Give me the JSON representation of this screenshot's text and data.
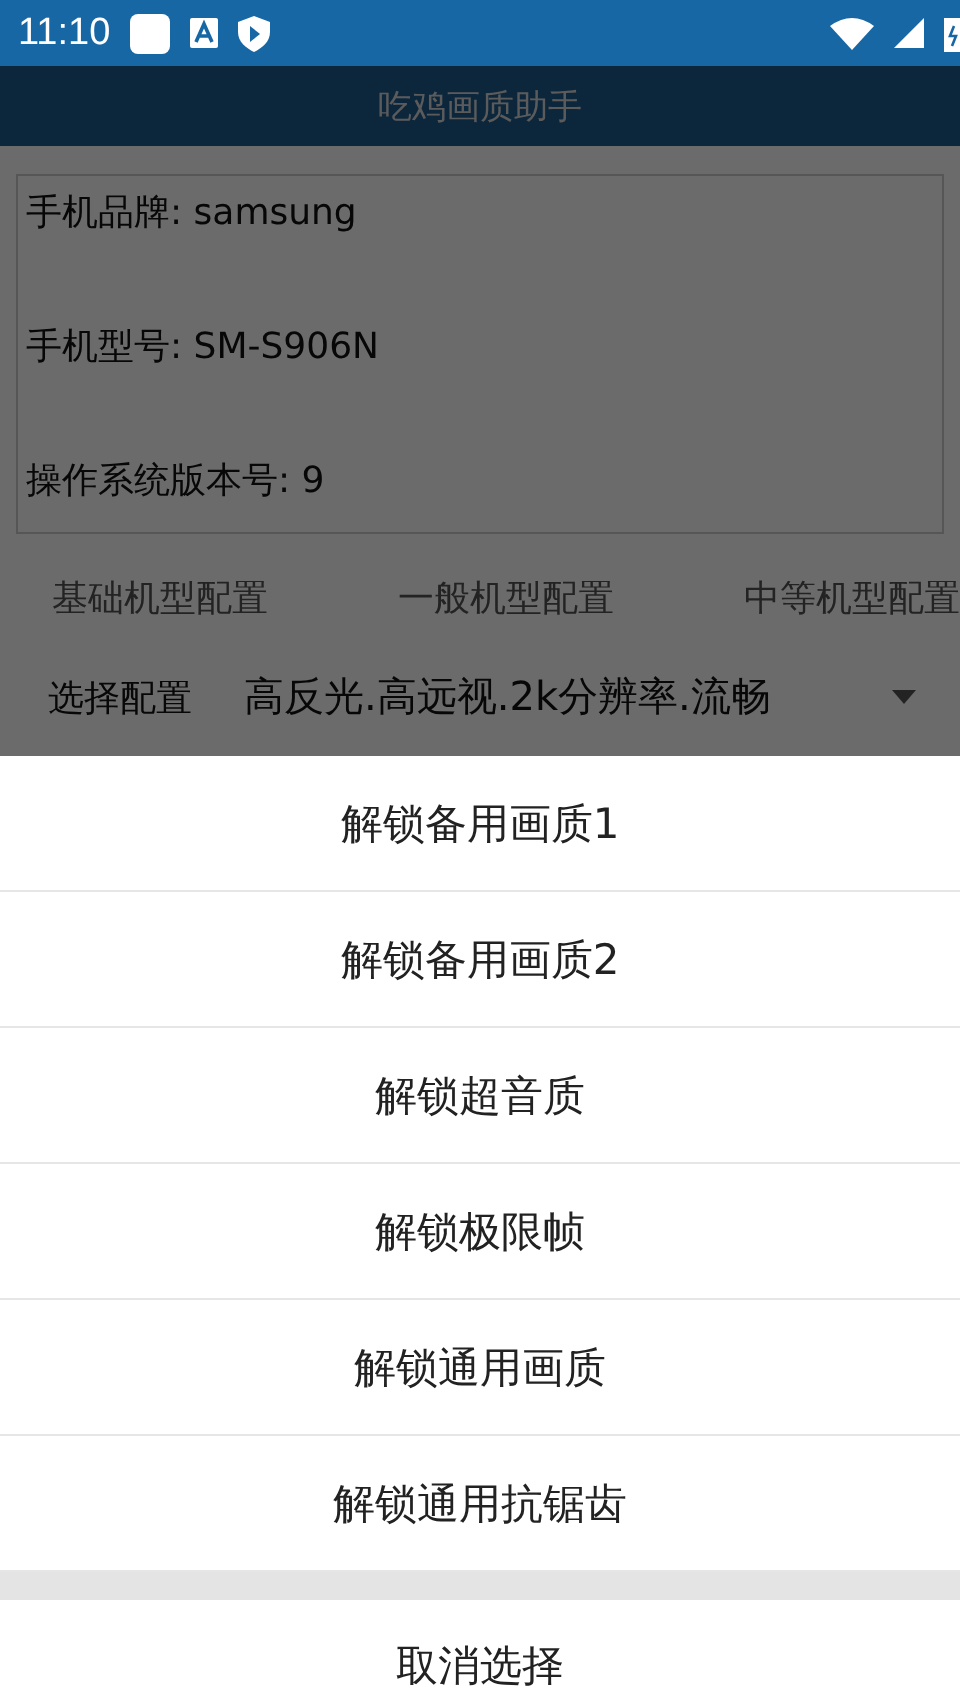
{
  "status_bar": {
    "time": "11:10"
  },
  "app_bar": {
    "title": "吃鸡画质助手"
  },
  "device_info": [
    "手机品牌: samsung",
    "手机型号: SM-S906N",
    "操作系统版本号: 9"
  ],
  "presets": [
    "基础机型配置",
    "一般机型配置",
    "中等机型配置"
  ],
  "config": {
    "label": "选择配置",
    "value": "高反光.高远视.2k分辨率.流畅"
  },
  "sheet": {
    "options": [
      "解锁备用画质1",
      "解锁备用画质2",
      "解锁超音质",
      "解锁极限帧",
      "解锁通用画质",
      "解锁通用抗锯齿"
    ],
    "cancel": "取消选择"
  }
}
